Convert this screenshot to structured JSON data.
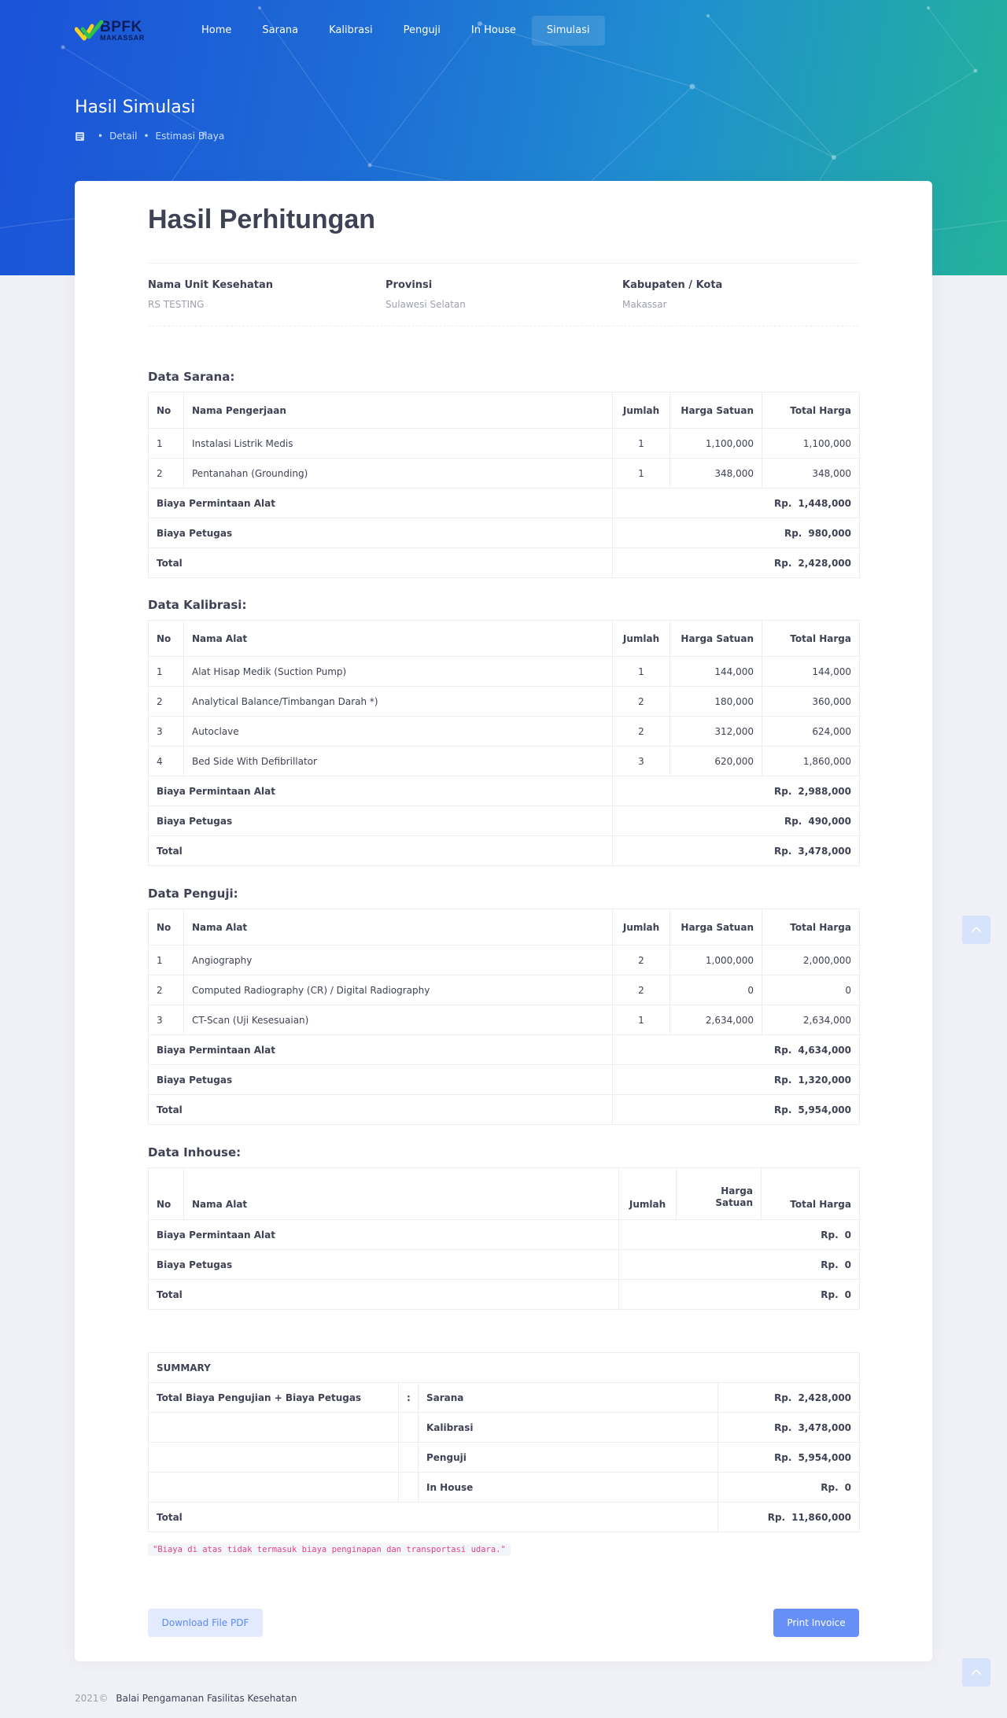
{
  "brand": {
    "name": "BPFK",
    "sub": "MAKASSAR"
  },
  "nav": [
    "Home",
    "Sarana",
    "Kalibrasi",
    "Penguji",
    "In House",
    "Simulasi"
  ],
  "hero": {
    "title": "Hasil Simulasi",
    "crumbs": [
      "Detail",
      "Estimasi Biaya"
    ]
  },
  "card": {
    "title": "Hasil Perhitungan",
    "info": [
      {
        "label": "Nama Unit Kesehatan",
        "value": "RS TESTING"
      },
      {
        "label": "Provinsi",
        "value": "Sulawesi Selatan"
      },
      {
        "label": "Kabupaten / Kota",
        "value": "Makassar"
      }
    ]
  },
  "rp": "Rp.",
  "sarana": {
    "title": "Data Sarana:",
    "headers": [
      "No",
      "Nama Pengerjaan",
      "Jumlah",
      "Harga Satuan",
      "Total Harga"
    ],
    "rows": [
      [
        "1",
        "Instalasi Listrik Medis",
        "1",
        "1,100,000",
        "1,100,000"
      ],
      [
        "2",
        "Pentanahan (Grounding)",
        "1",
        "348,000",
        "348,000"
      ]
    ],
    "totals": [
      {
        "label": "Biaya Permintaan Alat",
        "value": "1,448,000"
      },
      {
        "label": "Biaya Petugas",
        "value": "980,000"
      },
      {
        "label": "Total",
        "value": "2,428,000"
      }
    ]
  },
  "kalibrasi": {
    "title": "Data Kalibrasi:",
    "headers": [
      "No",
      "Nama Alat",
      "Jumlah",
      "Harga Satuan",
      "Total Harga"
    ],
    "rows": [
      [
        "1",
        "Alat Hisap Medik (Suction Pump)",
        "1",
        "144,000",
        "144,000"
      ],
      [
        "2",
        "Analytical Balance/Timbangan Darah *)",
        "2",
        "180,000",
        "360,000"
      ],
      [
        "3",
        "Autoclave",
        "2",
        "312,000",
        "624,000"
      ],
      [
        "4",
        "Bed Side With Defibrillator",
        "3",
        "620,000",
        "1,860,000"
      ]
    ],
    "totals": [
      {
        "label": "Biaya Permintaan Alat",
        "value": "2,988,000"
      },
      {
        "label": "Biaya Petugas",
        "value": "490,000"
      },
      {
        "label": "Total",
        "value": "3,478,000"
      }
    ]
  },
  "penguji": {
    "title": "Data Penguji:",
    "headers": [
      "No",
      "Nama Alat",
      "Jumlah",
      "Harga Satuan",
      "Total Harga"
    ],
    "rows": [
      [
        "1",
        "Angiography",
        "2",
        "1,000,000",
        "2,000,000"
      ],
      [
        "2",
        "Computed Radiography (CR) / Digital Radiography",
        "2",
        "0",
        "0"
      ],
      [
        "3",
        "CT-Scan (Uji Kesesuaian)",
        "1",
        "2,634,000",
        "2,634,000"
      ]
    ],
    "totals": [
      {
        "label": "Biaya Permintaan Alat",
        "value": "4,634,000"
      },
      {
        "label": "Biaya Petugas",
        "value": "1,320,000"
      },
      {
        "label": "Total",
        "value": "5,954,000"
      }
    ]
  },
  "inhouse": {
    "title": "Data Inhouse:",
    "headers": [
      "No",
      "Nama Alat",
      "Jumlah",
      "Harga Satuan",
      "Total Harga"
    ],
    "rows": [],
    "totals": [
      {
        "label": "Biaya Permintaan Alat",
        "value": "0"
      },
      {
        "label": "Biaya Petugas",
        "value": "0"
      },
      {
        "label": "Total",
        "value": "0"
      }
    ]
  },
  "summary": {
    "title": "SUMMARY",
    "label": "Total Biaya Pengujian + Biaya Petugas",
    "colon": ":",
    "items": [
      {
        "name": "Sarana",
        "value": "2,428,000"
      },
      {
        "name": "Kalibrasi",
        "value": "3,478,000"
      },
      {
        "name": "Penguji",
        "value": "5,954,000"
      },
      {
        "name": "In House",
        "value": "0"
      }
    ],
    "total_label": "Total",
    "total_value": "11,860,000"
  },
  "note": "\"Biaya di atas tidak termasuk biaya penginapan dan transportasi udara.\"",
  "buttons": {
    "pdf": "Download File PDF",
    "print": "Print Invoice"
  },
  "footer": {
    "year": "2021©",
    "org": "Balai Pengamanan Fasilitas Kesehatan"
  },
  "colors": {
    "primary": "#6690f5",
    "primary_light": "#e1eaff",
    "code_pink": "#e83e8c"
  },
  "icons": {
    "crumb": "home-icon",
    "scroll": "arrow-up-icon"
  }
}
